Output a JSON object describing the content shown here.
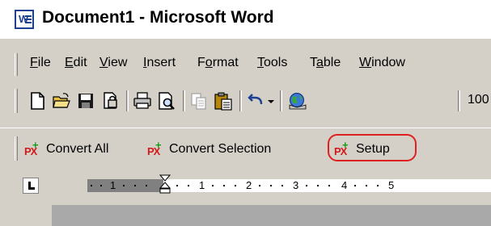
{
  "window": {
    "title": "Document1 - Microsoft Word",
    "app_icon": "word-icon"
  },
  "menu": {
    "items": [
      {
        "pre": "",
        "ul": "F",
        "post": "ile"
      },
      {
        "pre": "",
        "ul": "E",
        "post": "dit"
      },
      {
        "pre": "",
        "ul": "V",
        "post": "iew"
      },
      {
        "pre": "",
        "ul": "I",
        "post": "nsert"
      },
      {
        "pre": "F",
        "ul": "o",
        "post": "rmat"
      },
      {
        "pre": "",
        "ul": "T",
        "post": "ools"
      },
      {
        "pre": "T",
        "ul": "a",
        "post": "ble"
      },
      {
        "pre": "",
        "ul": "W",
        "post": "indow"
      }
    ]
  },
  "toolbar": {
    "icons": [
      "new-document-icon",
      "open-folder-icon",
      "save-icon",
      "permission-icon",
      "print-icon",
      "print-preview-icon",
      "copy-icon",
      "paste-icon",
      "undo-icon",
      "undo-dropdown-icon",
      "web-globe-icon"
    ],
    "zoom": "100"
  },
  "px_toolbar": {
    "convert_all": "Convert All",
    "convert_selection": "Convert Selection",
    "setup": "Setup",
    "logo_text": "PX",
    "highlight_color": "#e02020"
  },
  "ruler": {
    "numbers": [
      "1",
      "1",
      "2",
      "3",
      "4",
      "5"
    ]
  }
}
